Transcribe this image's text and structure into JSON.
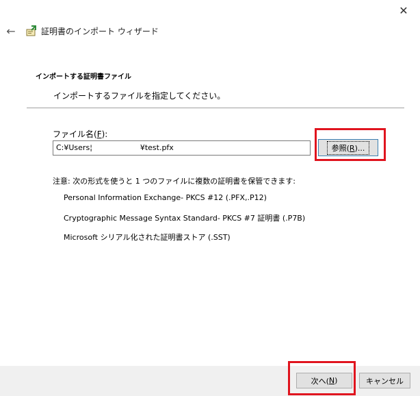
{
  "window": {
    "close_glyph": "✕",
    "back_glyph": "←",
    "title": "証明書のインポート ウィザード"
  },
  "section": {
    "title": "インポートする証明書ファイル",
    "subtitle": "インポートするファイルを指定してください。"
  },
  "file": {
    "label_prefix": "ファイル名(",
    "label_mnemonic": "F",
    "label_suffix": "):",
    "value": "C:¥Users¦                    ¥test.pfx",
    "browse_prefix": "参照(",
    "browse_mnemonic": "R",
    "browse_suffix": ")..."
  },
  "note": "注意: 次の形式を使うと 1 つのファイルに複数の証明書を保管できます:",
  "formats": [
    "Personal Information Exchange- PKCS #12 (.PFX,.P12)",
    "Cryptographic Message Syntax Standard- PKCS #7 証明書 (.P7B)",
    "Microsoft シリアル化された証明書ストア (.SST)"
  ],
  "footer": {
    "next_prefix": "次へ(",
    "next_mnemonic": "N",
    "next_suffix": ")",
    "cancel_label": "キャンセル"
  },
  "colors": {
    "highlight": "#e0141e",
    "button_focus_border": "#3c7fb1",
    "footer_bg": "#f0f0f0"
  },
  "icons": {
    "close": "close-icon",
    "back": "back-arrow-icon",
    "wizard": "certificate-wizard-icon"
  }
}
